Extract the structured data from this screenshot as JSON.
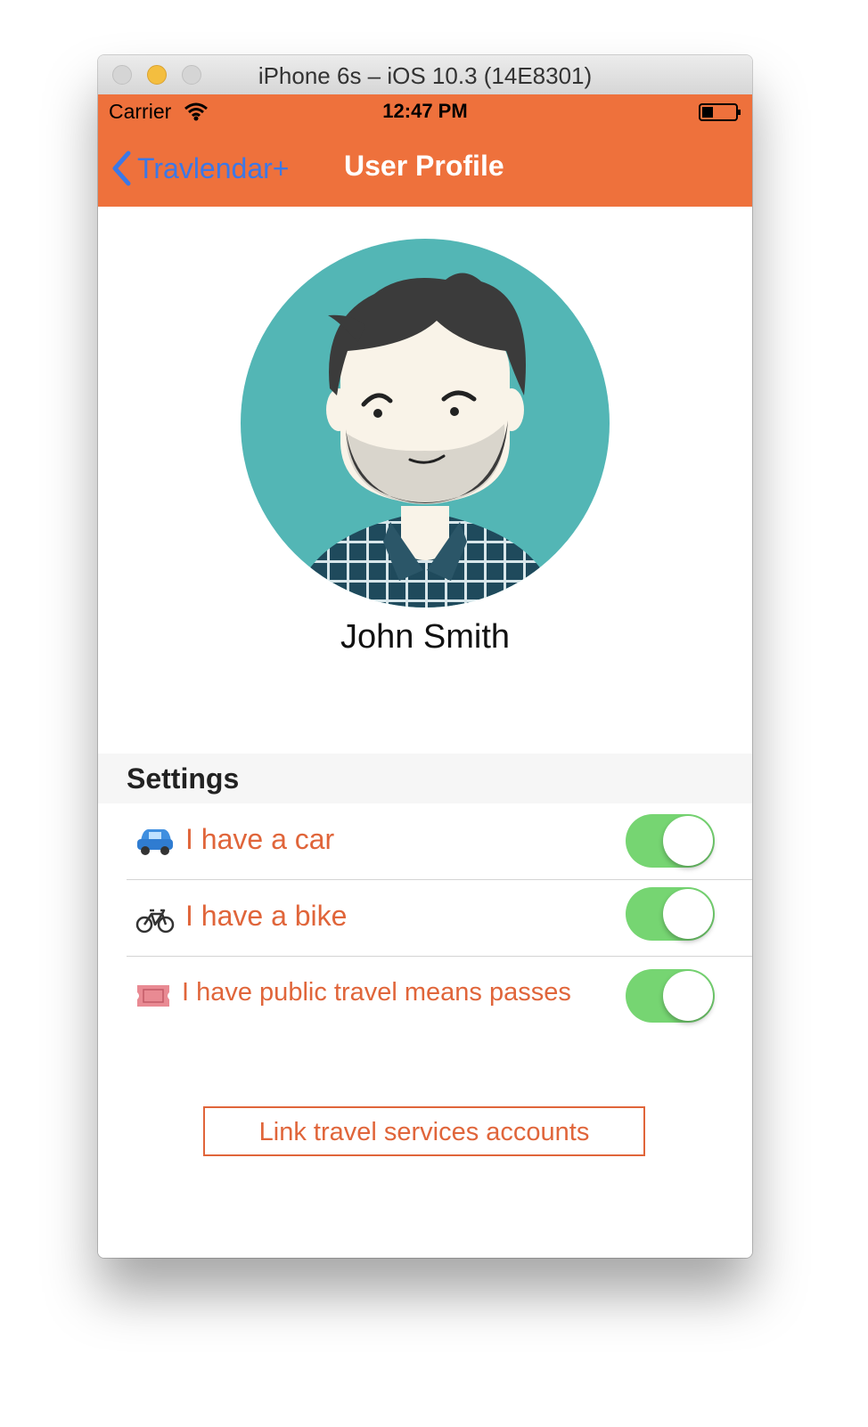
{
  "window": {
    "title": "iPhone 6s – iOS 10.3 (14E8301)"
  },
  "statusbar": {
    "carrier": "Carrier",
    "time": "12:47 PM"
  },
  "navbar": {
    "back_label": "Travlendar+",
    "title": "User Profile"
  },
  "profile": {
    "name": "John Smith"
  },
  "settings": {
    "title": "Settings",
    "items": [
      {
        "icon": "car-icon",
        "label": "I have a car",
        "enabled": true
      },
      {
        "icon": "bicycle-icon",
        "label": "I have a bike",
        "enabled": true
      },
      {
        "icon": "ticket-icon",
        "label": "I have public travel means passes",
        "enabled": true
      }
    ]
  },
  "link_button": {
    "label": "Link travel services accounts"
  },
  "colors": {
    "accent": "#ee713c",
    "text_accent": "#e0653a",
    "back_link": "#3b78e7",
    "toggle_on": "#76d572"
  }
}
